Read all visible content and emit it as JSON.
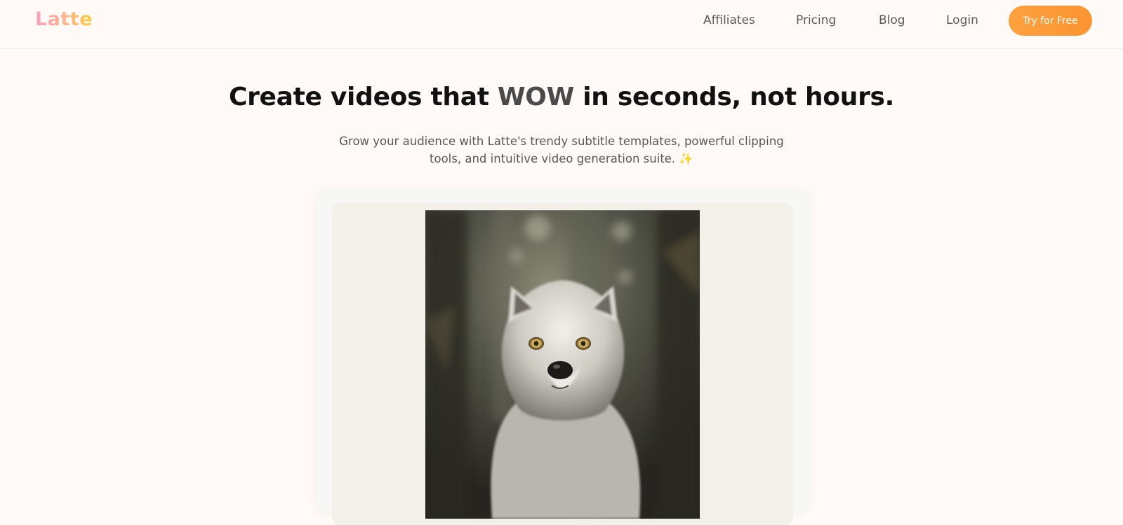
{
  "nav": {
    "logo": "Latte",
    "links": {
      "affiliates": "Affiliates",
      "pricing": "Pricing",
      "blog": "Blog",
      "login": "Login"
    },
    "cta": "Try for Free"
  },
  "hero": {
    "title_before": "Create videos that ",
    "title_highlight": "WOW",
    "title_after": " in seconds, not hours.",
    "subtitle": "Grow your audience with Latte's trendy subtitle templates, powerful clipping tools, and intuitive video generation suite. ✨"
  },
  "demo": {
    "image_subject": "white-wolf-in-forest"
  }
}
